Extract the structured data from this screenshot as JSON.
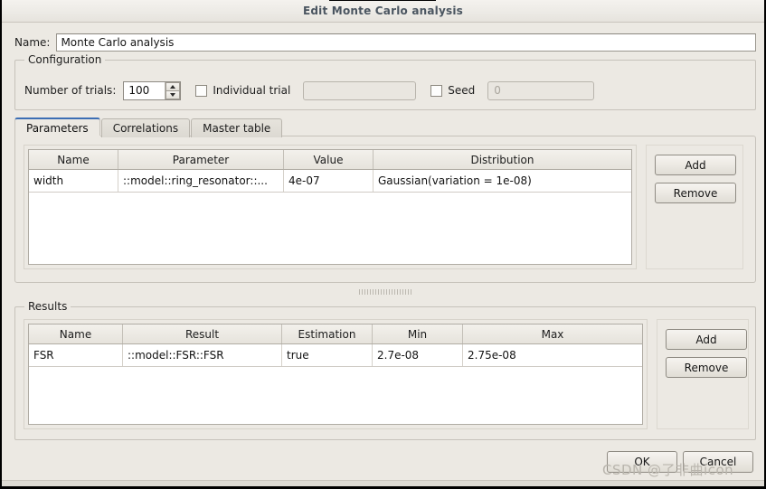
{
  "window": {
    "title": "Edit Monte Carlo analysis"
  },
  "name_row": {
    "label": "Name:",
    "value": "Monte Carlo analysis"
  },
  "configuration": {
    "title": "Configuration",
    "trials_label": "Number of trials:",
    "trials_value": "100",
    "individual_trial_label": "Individual trial",
    "individual_trial_checked": false,
    "individual_trial_value": "",
    "seed_label": "Seed",
    "seed_checked": false,
    "seed_value": "0"
  },
  "tabs": [
    {
      "label": "Parameters",
      "active": true
    },
    {
      "label": "Correlations",
      "active": false
    },
    {
      "label": "Master table",
      "active": false
    }
  ],
  "parameters_table": {
    "columns": [
      "Name",
      "Parameter",
      "Value",
      "Distribution"
    ],
    "rows": [
      {
        "name": "width",
        "parameter": "::model::ring_resonator::...",
        "value": "4e-07",
        "distribution": "Gaussian(variation = 1e-08)"
      }
    ],
    "add_label": "Add",
    "remove_label": "Remove"
  },
  "results": {
    "title": "Results",
    "columns": [
      "Name",
      "Result",
      "Estimation",
      "Min",
      "Max"
    ],
    "rows": [
      {
        "name": "FSR",
        "result": "::model::FSR::FSR",
        "estimation": "true",
        "min": "2.7e-08",
        "max": "2.75e-08"
      }
    ],
    "add_label": "Add",
    "remove_label": "Remove"
  },
  "footer": {
    "ok_label": "OK",
    "cancel_label": "Cancel"
  },
  "watermark": {
    "text": "CSDN @了非曲icon"
  },
  "colors": {
    "window_background": "#ece9e3",
    "title_text": "#4a5560",
    "active_tab_accent": "#3c6eb4",
    "field_background": "#ffffff",
    "disabled_text": "#a9a59d",
    "watermark": "#b9b5ad"
  }
}
